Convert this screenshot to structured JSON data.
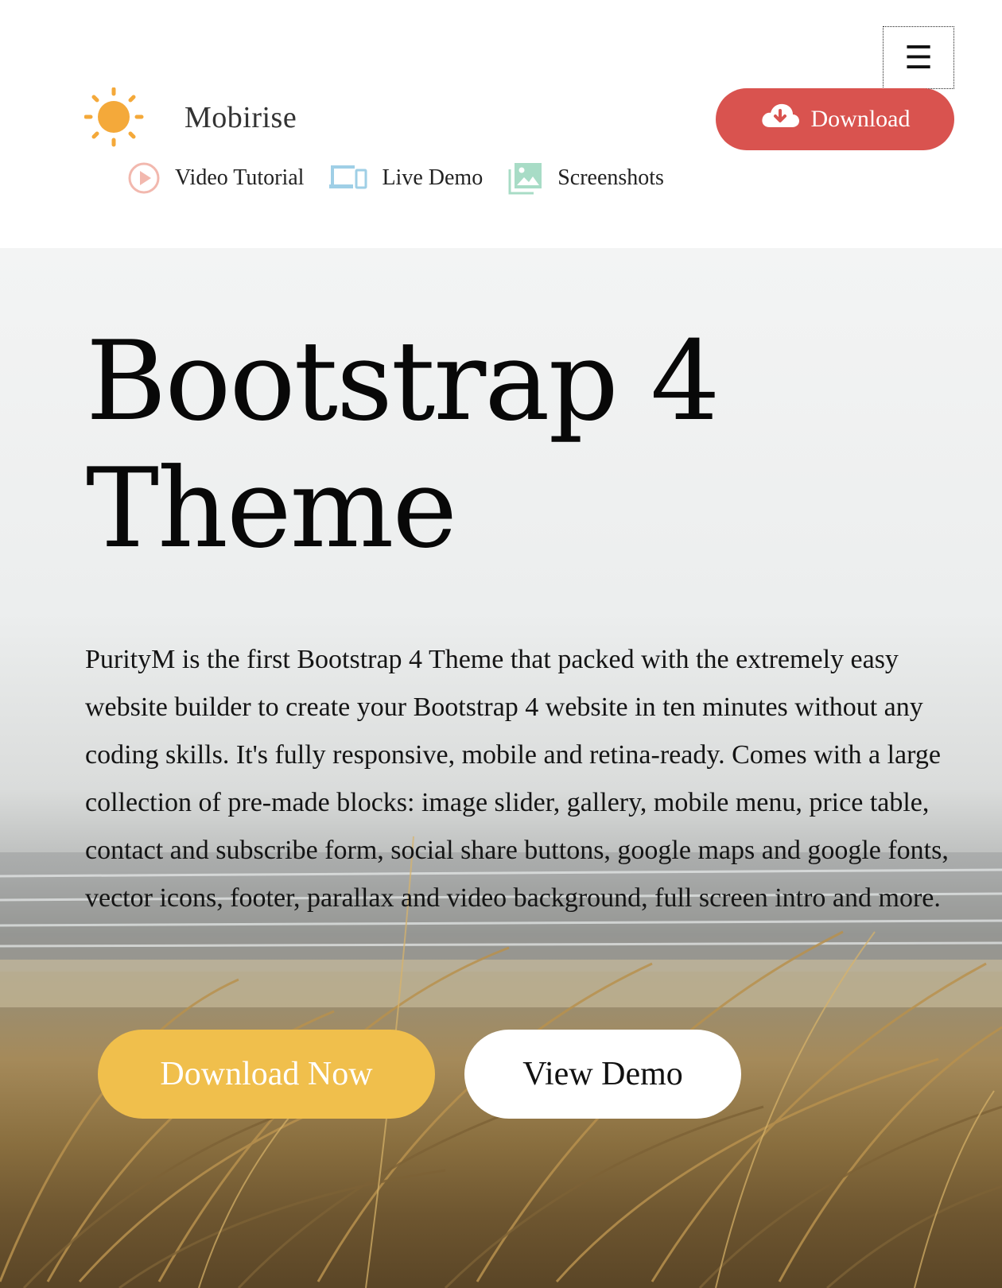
{
  "header": {
    "menu_toggle_glyph": "☰",
    "brand": {
      "name": "Mobirise",
      "logo_icon": "sun-icon",
      "logo_color": "#f4a93a"
    },
    "download_button": {
      "label": "Download",
      "icon": "cloud-download-icon",
      "color": "#d9534f"
    },
    "nav": [
      {
        "label": "Video Tutorial",
        "icon": "play-circle-icon",
        "icon_color": "#f2b8ae"
      },
      {
        "label": "Live Demo",
        "icon": "devices-icon",
        "icon_color": "#9fcfe6"
      },
      {
        "label": "Screenshots",
        "icon": "image-gallery-icon",
        "icon_color": "#a8dcc6"
      }
    ]
  },
  "hero": {
    "title_line1": "Bootstrap 4",
    "title_line2": "Theme",
    "description": "PurityM is the first Bootstrap 4 Theme that packed with the extremely easy website builder to create your Bootstrap 4 website in ten minutes without any coding skills. It's fully responsive, mobile and retina-ready. Comes with a large collection of pre-made blocks: image slider, gallery, mobile menu, price table, contact and subscribe form,  social share buttons, google maps and google fonts, vector icons, footer, parallax and video background, full screen intro and more.",
    "primary_button": {
      "label": "Download Now",
      "color": "#f0bf4c"
    },
    "secondary_button": {
      "label": "View Demo",
      "color": "#ffffff"
    }
  }
}
